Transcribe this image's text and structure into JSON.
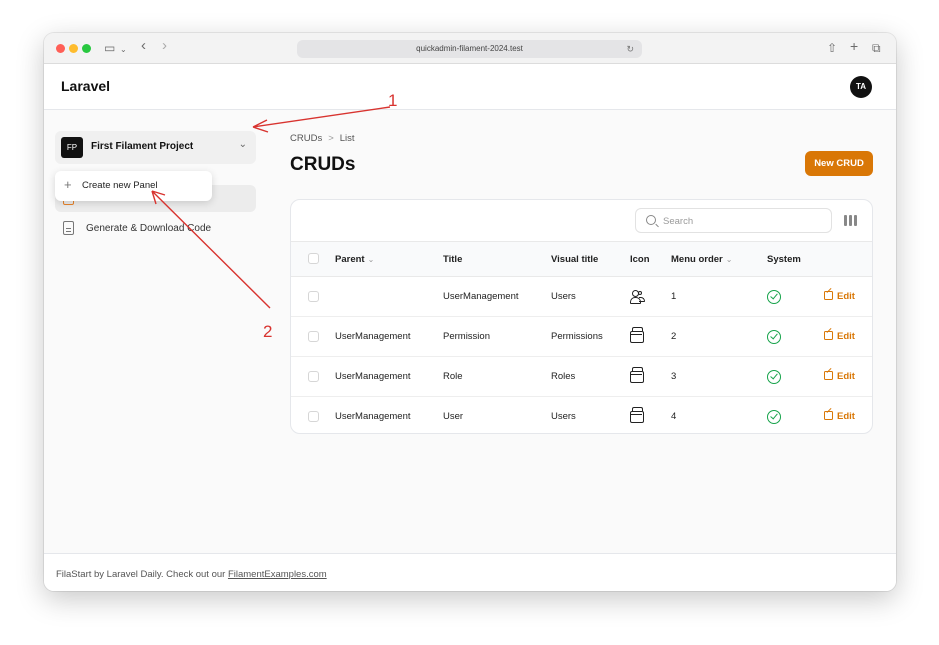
{
  "browser": {
    "url": "quickadmin-filament-2024.test",
    "traffic_colors": [
      "#ff5f57",
      "#febc2e",
      "#28c840"
    ]
  },
  "header": {
    "brand": "Laravel",
    "avatar_initials": "TA"
  },
  "sidebar": {
    "project": {
      "badge": "FP",
      "name": "First Filament Project"
    },
    "dropdown_item": "Create new Panel",
    "nav_items": [
      {
        "label": "Generate & Download Code"
      }
    ]
  },
  "breadcrumb": {
    "items": [
      "CRUDs",
      "List"
    ]
  },
  "page": {
    "title": "CRUDs",
    "new_button": "New CRUD"
  },
  "table": {
    "search_placeholder": "Search",
    "columns": [
      "Parent",
      "Title",
      "Visual title",
      "Icon",
      "Menu order",
      "System"
    ],
    "rows": [
      {
        "parent": "",
        "title": "UserManagement",
        "visual_title": "Users",
        "icon": "users-icon",
        "menu_order": "1",
        "system": true,
        "action": "Edit"
      },
      {
        "parent": "UserManagement",
        "title": "Permission",
        "visual_title": "Permissions",
        "icon": "archive-icon",
        "menu_order": "2",
        "system": true,
        "action": "Edit"
      },
      {
        "parent": "UserManagement",
        "title": "Role",
        "visual_title": "Roles",
        "icon": "archive-icon",
        "menu_order": "3",
        "system": true,
        "action": "Edit"
      },
      {
        "parent": "UserManagement",
        "title": "User",
        "visual_title": "Users",
        "icon": "archive-icon",
        "menu_order": "4",
        "system": true,
        "action": "Edit"
      }
    ]
  },
  "footer": {
    "text": "FilaStart by Laravel Daily. Check out our ",
    "link": "FilamentExamples.com"
  },
  "annotations": {
    "marker_1": "1",
    "marker_2": "2",
    "color": "#d8332f"
  },
  "colors": {
    "accent": "#d97706",
    "success": "#16a34a"
  }
}
